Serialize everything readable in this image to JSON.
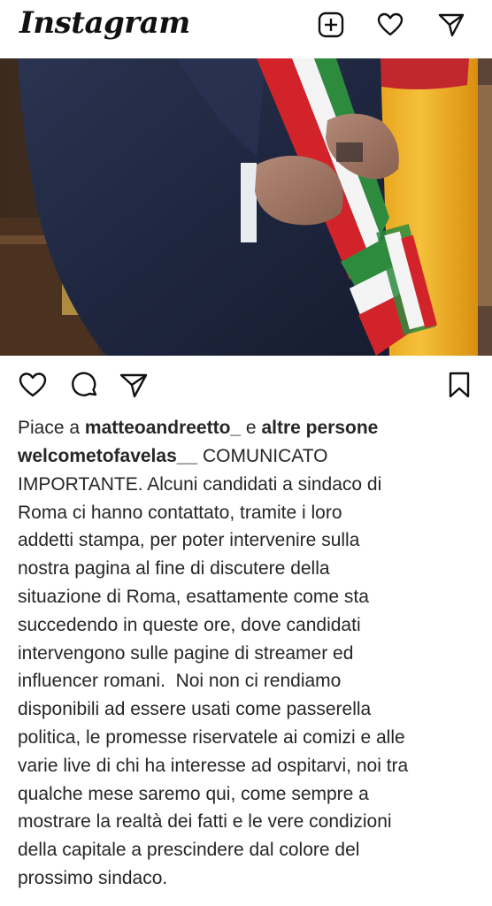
{
  "header": {
    "logo": "Instagram",
    "icons": [
      "new-post-icon",
      "heart-icon",
      "direct-message-icon"
    ]
  },
  "post": {
    "actions": [
      "like-icon",
      "comment-icon",
      "share-icon",
      "save-icon"
    ],
    "likes": {
      "prefix": "Piace a ",
      "user": "matteoandreetto_",
      "middle": " e ",
      "others": "altre persone"
    },
    "caption": {
      "user": "welcometofavelas__",
      "first_line_rest": " COMUNICATO",
      "lines": [
        "IMPORTANTE. Alcuni candidati a sindaco di",
        "Roma ci hanno contattato, tramite i loro",
        "addetti stampa, per poter intervenire sulla",
        "nostra pagina al fine di discutere della",
        "situazione di Roma, esattamente come sta",
        "succedendo in queste ore, dove candidati",
        "intervengono sulle pagine di streamer ed",
        "influencer romani.  Noi non ci rendiamo",
        "disponibili ad essere usati come passerella",
        "politica, le promesse riservatele ai comizi e alle",
        "varie live di chi ha interesse ad ospitarvi, noi tra",
        "qualche mese saremo qui, come sempre a",
        "mostrare la realtà dei fatti e le vere condizioni",
        "della capitale a prescindere dal colore del",
        "prossimo sindaco."
      ]
    }
  },
  "colors": {
    "text": "#262626",
    "flag_green": "#2e8b3e",
    "flag_red": "#d2232a",
    "flag_gold": "#f2b41f"
  }
}
